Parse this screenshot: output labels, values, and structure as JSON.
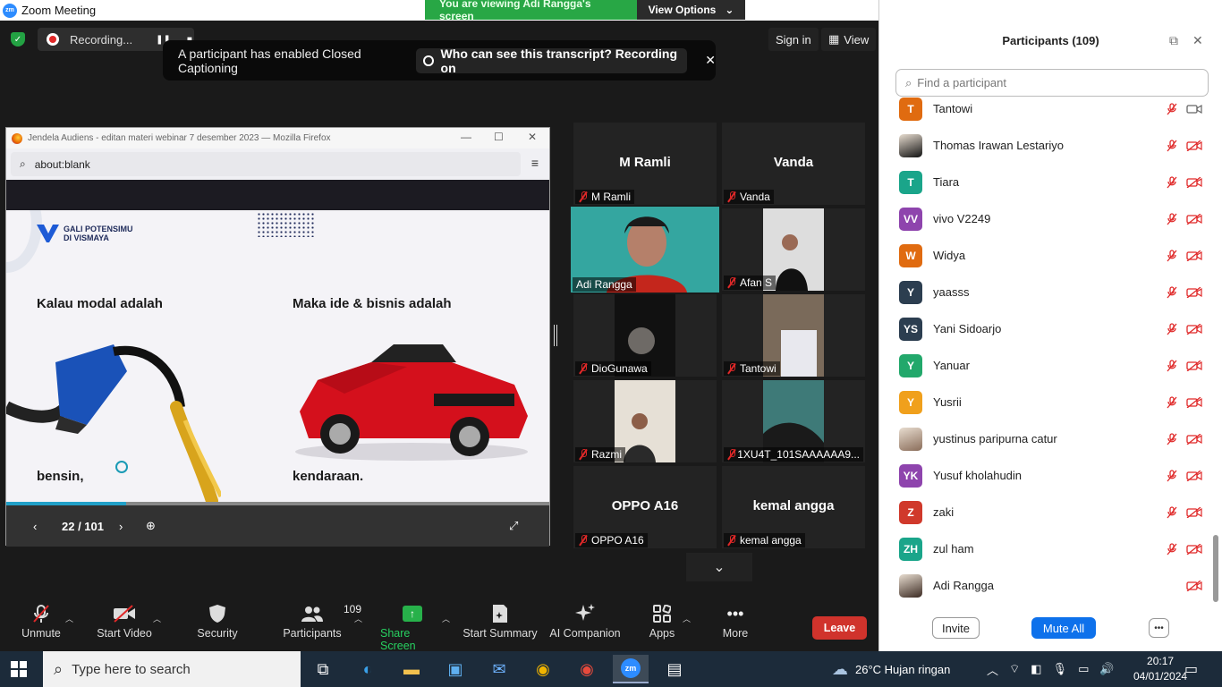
{
  "window": {
    "app_title": "Zoom Meeting"
  },
  "banner": {
    "viewing": "You are viewing Adi Rangga's screen",
    "view_options": "View Options"
  },
  "recording": {
    "label": "Recording..."
  },
  "caption_notice": {
    "text": "A participant has enabled Closed Captioning",
    "link": "Who can see this transcript? Recording on"
  },
  "topbar": {
    "sign_in": "Sign in",
    "view": "View"
  },
  "firefox": {
    "title": "Jendela Audiens - editan materi webinar 7 desember 2023 — Mozilla Firefox",
    "url": "about:blank"
  },
  "slide": {
    "logo_line1": "GALI POTENSIMU",
    "logo_line2": "DI VISMAYA",
    "left_heading": "Kalau modal adalah",
    "right_heading": "Maka ide & bisnis adalah",
    "left_bottom": "bensin,",
    "right_bottom": "kendaraan.",
    "progress": 0.22
  },
  "pdf": {
    "page": "22 / 101"
  },
  "tiles": [
    {
      "name": "M Ramli",
      "big": "M Ramli"
    },
    {
      "name": "Vanda",
      "big": "Vanda"
    },
    {
      "name": "Adi Rangga"
    },
    {
      "name": "Afan S"
    },
    {
      "name": "DioGunawa"
    },
    {
      "name": "Tantowi"
    },
    {
      "name": "Razmi"
    },
    {
      "name": "1XU4T_101SAAAAAA9..."
    },
    {
      "name": "OPPO A16",
      "big": "OPPO A16"
    },
    {
      "name": "kemal angga",
      "big": "kemal angga"
    }
  ],
  "toolbar": {
    "unmute": "Unmute",
    "start_video": "Start Video",
    "security": "Security",
    "participants": "Participants",
    "participants_count": "109",
    "share_screen": "Share Screen",
    "start_summary": "Start Summary",
    "ai_companion": "AI Companion",
    "apps": "Apps",
    "more": "More",
    "leave": "Leave"
  },
  "panel": {
    "title": "Participants (109)",
    "search_placeholder": "Find a participant",
    "invite": "Invite",
    "mute_all": "Mute All",
    "participants": [
      {
        "initials": "T",
        "name": "Tantowi",
        "color": "#e06b10"
      },
      {
        "initials": "",
        "name": "Thomas Irawan Lestariyo",
        "color": "#111111"
      },
      {
        "initials": "T",
        "name": "Tiara",
        "color": "#1aa58a"
      },
      {
        "initials": "VV",
        "name": "vivo V2249",
        "color": "#8e44ad"
      },
      {
        "initials": "W",
        "name": "Widya",
        "color": "#e06b10"
      },
      {
        "initials": "Y",
        "name": "yaasss",
        "color": "#2c3e50"
      },
      {
        "initials": "YS",
        "name": "Yani Sidoarjo",
        "color": "#2c3e50"
      },
      {
        "initials": "Y",
        "name": "Yanuar",
        "color": "#22a86b"
      },
      {
        "initials": "Y",
        "name": "Yusrii",
        "color": "#f0a01c"
      },
      {
        "initials": "",
        "name": "yustinus paripurna catur",
        "color": "#8a6d5a"
      },
      {
        "initials": "YK",
        "name": "Yusuf kholahudin",
        "color": "#8e44ad"
      },
      {
        "initials": "Z",
        "name": "zaki",
        "color": "#d0392b"
      },
      {
        "initials": "ZH",
        "name": "zul ham",
        "color": "#1aa58a"
      },
      {
        "initials": "",
        "name": "Adi Rangga",
        "color": "#3b2a22"
      }
    ]
  },
  "taskbar": {
    "search_placeholder": "Type here to search",
    "weather": "26°C  Hujan ringan",
    "time": "20:17",
    "date": "04/01/2024"
  }
}
